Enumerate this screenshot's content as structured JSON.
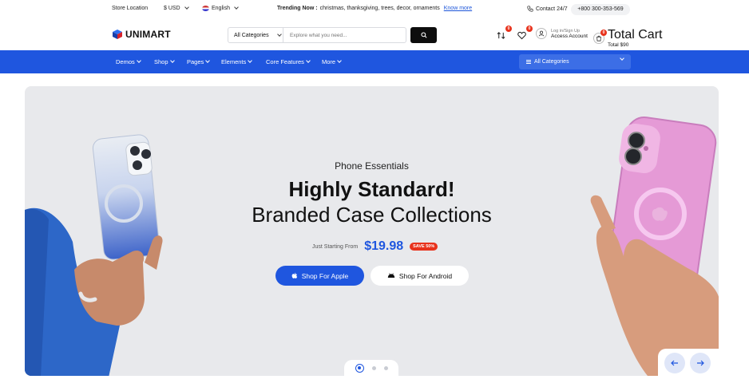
{
  "topbar": {
    "store_location": "Store Location",
    "currency": "$ USD",
    "language": "English",
    "trending_label": "Trending Now :",
    "trending_items": "christmas, thanksgiving, trees, decor, ornaments",
    "know_more": "Know more",
    "contact": "Contact 24/7",
    "phone": "+800 300-353-569"
  },
  "header": {
    "logo_text": "UNIMART",
    "search_category": "All Categories",
    "search_placeholder": "Explore what you need...",
    "compare_count": "0",
    "wishlist_count": "0",
    "account_small": "Log in/Sign Up",
    "account_big": "Access Account",
    "cart_count": "0",
    "cart_small": "Total Cart",
    "cart_big": "Total $90"
  },
  "nav": {
    "items": [
      "Demos",
      "Shop",
      "Pages",
      "Elements",
      "Core Features",
      "More"
    ],
    "all_categories": "All Categories"
  },
  "hero": {
    "eyebrow": "Phone Essentials",
    "title_line1": "Highly Standard!",
    "title_line2": "Branded Case Collections",
    "starting_from": "Just Starting From",
    "price": "$19.98",
    "sale_badge": "SAVE 50%",
    "btn_apple": "Shop For Apple",
    "btn_android": "Shop For Android"
  },
  "colors": {
    "accent": "#1f56df",
    "sale": "#e8321c",
    "hero_bg": "#e8e9ec"
  },
  "slider": {
    "total_slides": 3,
    "active_slide": 1
  }
}
